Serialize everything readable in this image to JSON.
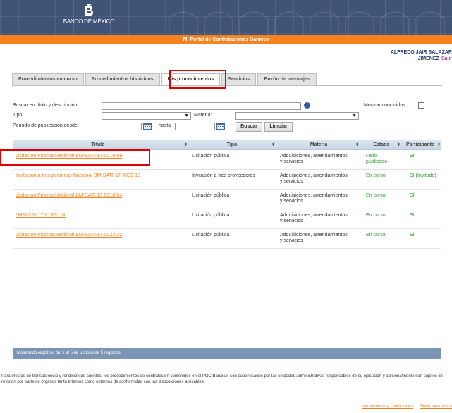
{
  "header": {
    "logo_text": "BANCO DE MÉXICO",
    "portal_title": "Mi Portal de Contrataciones Banxico"
  },
  "user": {
    "name_line1": "ALFREDO JAIR SALAZAR",
    "name_line2": "JIMENEZ",
    "logout": "Salir"
  },
  "tabs": [
    {
      "label": "Procedimientos en curso",
      "active": false
    },
    {
      "label": "Procedimientos históricos",
      "active": false
    },
    {
      "label": "Mis procedimientos",
      "active": true
    },
    {
      "label": "Servicios",
      "active": false
    },
    {
      "label": "Buzón de mensajes",
      "active": false
    }
  ],
  "search": {
    "title_label": "Buscar en título y descripción:",
    "title_value": "",
    "show_completed_label": "Mostrar concluidos:",
    "tipo_label": "Tipo:",
    "tipo_value": "",
    "materia_label": "Materia:",
    "materia_value": "",
    "period_label": "Periodo de publicación desde:",
    "from_value": "",
    "to_label": "hasta",
    "to_value": "",
    "search_button": "Buscar",
    "clear_button": "Limpiar"
  },
  "grid": {
    "columns": [
      "Título",
      "Tipo",
      "Materia",
      "Estado",
      "Participante"
    ],
    "rows": [
      {
        "titulo": "Licitación Pública Nacional BM-SATI-17-0018-59",
        "tipo": "Licitación pública",
        "materia_1": "Adquisiciones, arrendamientos",
        "materia_2": "y servicios",
        "estado_1": "Fallo",
        "estado_2": "publicado",
        "participante": "Sí"
      },
      {
        "titulo": "Invitación a tres personas Nacional BM-SATI-17-0003-18",
        "tipo": "Invitación a tres proveedores",
        "materia_1": "Adquisiciones, arrendamientos",
        "materia_2": "y servicios",
        "estado_1": "En curso",
        "estado_2": "",
        "participante": "Sí (Invitado)"
      },
      {
        "titulo": "Licitación Pública Nacional BM-SATI-17-0018-54",
        "tipo": "Licitación pública",
        "materia_1": "Adquisiciones, arrendamientos",
        "materia_2": "y servicios",
        "estado_1": "En curso",
        "estado_2": "",
        "participante": "Sí"
      },
      {
        "titulo": "DRM-LID-17-0182-1 tit",
        "tipo": "Licitación pública",
        "materia_1": "Adquisiciones, arrendamientos",
        "materia_2": "y servicios",
        "estado_1": "En curso",
        "estado_2": "",
        "participante": "Sí"
      },
      {
        "titulo": "Licitación Pública Nacional BM-SATI-17-0023-22",
        "tipo": "Licitación pública",
        "materia_1": "Adquisiciones, arrendamientos",
        "materia_2": "y servicios",
        "estado_1": "En curso",
        "estado_2": "",
        "participante": "Sí"
      }
    ],
    "footer": "Mostrando registros del 1 al 5 de un total de 5 registros"
  },
  "disclaimer": "Para efectos de transparencia y rendición de cuentas, los procedimientos de contratación contenidos en el POC Banxico, son supervisados por las unidades administrativas responsables de su ejecución y adicionalmente son sujetos de revisión por parte de órganos tanto internos como externos de conformidad con las disposiciones aplicables.",
  "footer_links": [
    "Ver términos y condiciones",
    "Firma electrónica"
  ],
  "colors": {
    "accent": "#f5821f",
    "header": "#3f5476",
    "link": "#f5821f",
    "status_green": "#2a9d2a",
    "highlight": "#e00000"
  }
}
